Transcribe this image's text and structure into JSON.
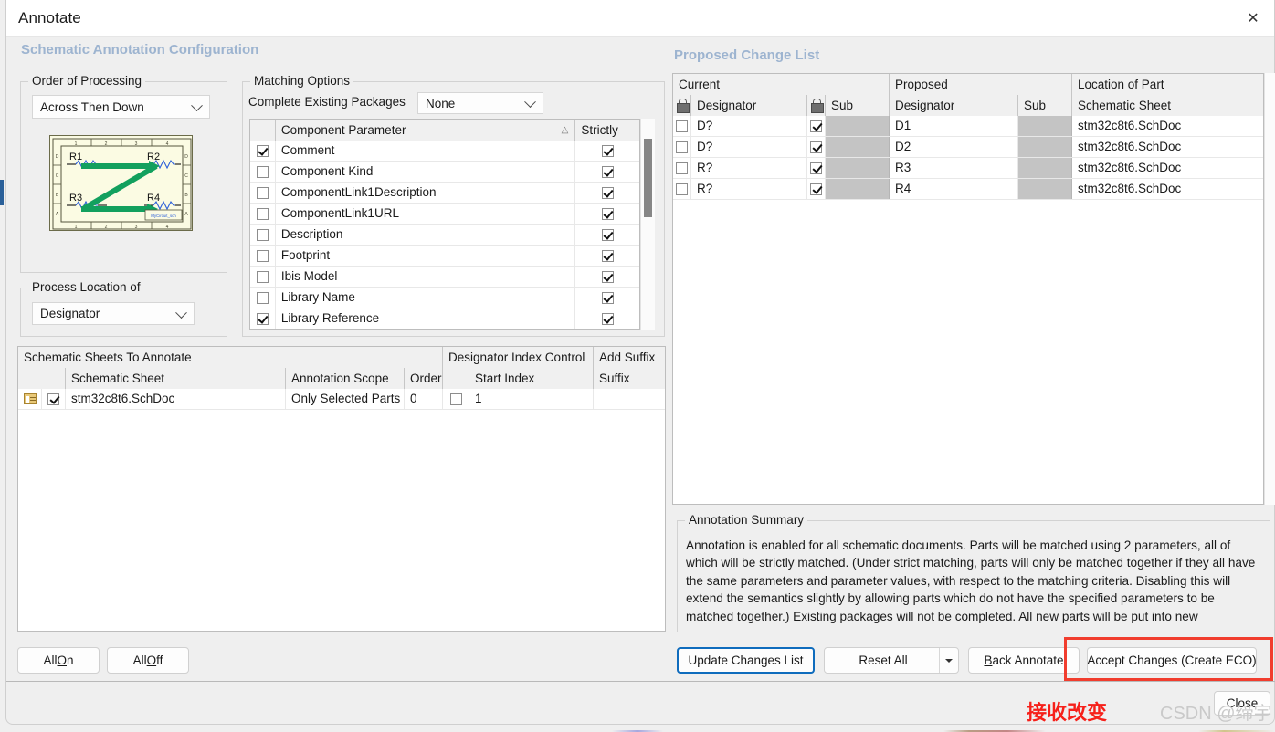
{
  "window": {
    "title": "Annotate",
    "close_icon": "close-icon"
  },
  "left_panel": {
    "heading": "Schematic Annotation Configuration",
    "order_of_processing": {
      "legend": "Order of Processing",
      "value": "Across Then Down",
      "chevron_icon": "chevron-down-icon",
      "preview": {
        "designators": [
          "R1",
          "R2",
          "R3",
          "R4"
        ],
        "border_labels_top": [
          "1",
          "2",
          "3",
          "4"
        ],
        "border_labels_bottom": [
          "1",
          "2",
          "3",
          "4"
        ],
        "border_labels_left": [
          "D",
          "C",
          "B",
          "A"
        ],
        "border_labels_right": [
          "D",
          "C",
          "B",
          "A"
        ],
        "title_block": "MyCircuit_sch",
        "arrow_color": "#12a05e",
        "sheet_color": "#fbfbe3"
      }
    },
    "process_location_of": {
      "legend": "Process Location of",
      "value": "Designator",
      "chevron_icon": "chevron-down-icon"
    },
    "matching_options": {
      "legend": "Matching Options",
      "complete_existing_packages_label": "Complete Existing Packages",
      "complete_existing_packages_value": "None",
      "chevron_icon": "chevron-down-icon",
      "columns": [
        "",
        "Component Parameter",
        "Strictly"
      ],
      "sort_indicator": "△",
      "rows": [
        {
          "checked": true,
          "parameter": "Comment",
          "strictly": true
        },
        {
          "checked": false,
          "parameter": "Component Kind",
          "strictly": true
        },
        {
          "checked": false,
          "parameter": "ComponentLink1Description",
          "strictly": true
        },
        {
          "checked": false,
          "parameter": "ComponentLink1URL",
          "strictly": true
        },
        {
          "checked": false,
          "parameter": "Description",
          "strictly": true
        },
        {
          "checked": false,
          "parameter": "Footprint",
          "strictly": true
        },
        {
          "checked": false,
          "parameter": "Ibis Model",
          "strictly": true
        },
        {
          "checked": false,
          "parameter": "Library Name",
          "strictly": true
        },
        {
          "checked": true,
          "parameter": "Library Reference",
          "strictly": true
        }
      ]
    },
    "sheets_grid": {
      "group_headers": [
        "Schematic Sheets To Annotate",
        "Designator Index Control",
        "Add Suffix"
      ],
      "columns": [
        "",
        "",
        "Schematic Sheet",
        "Annotation Scope",
        "Order",
        "",
        "Start Index",
        "Suffix"
      ],
      "rows": [
        {
          "doc_icon": "document-icon",
          "enabled": true,
          "schematic_sheet": "stm32c8t6.SchDoc",
          "annotation_scope": "Only Selected Parts",
          "order": "0",
          "index_enabled": false,
          "start_index": "1",
          "suffix": ""
        }
      ]
    },
    "buttons": {
      "all_on": {
        "pre": "All ",
        "accel": "O",
        "post": "n"
      },
      "all_off": {
        "pre": "All ",
        "accel": "O",
        "post": "ff"
      }
    }
  },
  "right_panel": {
    "heading": "Proposed Change List",
    "change_list": {
      "group_headers": [
        "Current",
        "Proposed",
        "Location of Part"
      ],
      "sub_headers": {
        "current_lock_icon": "lock-icon",
        "current_designator": "Designator",
        "current_sub_lock_icon": "lock-icon",
        "current_sub": "Sub",
        "proposed_designator": "Designator",
        "proposed_sub": "Sub",
        "location": "Schematic Sheet"
      },
      "rows": [
        {
          "selected": false,
          "current_designator": "D?",
          "current_sub_locked": true,
          "proposed_designator": "D1",
          "location": "stm32c8t6.SchDoc"
        },
        {
          "selected": false,
          "current_designator": "D?",
          "current_sub_locked": true,
          "proposed_designator": "D2",
          "location": "stm32c8t6.SchDoc"
        },
        {
          "selected": false,
          "current_designator": "R?",
          "current_sub_locked": true,
          "proposed_designator": "R3",
          "location": "stm32c8t6.SchDoc"
        },
        {
          "selected": false,
          "current_designator": "R?",
          "current_sub_locked": true,
          "proposed_designator": "R4",
          "location": "stm32c8t6.SchDoc"
        }
      ]
    },
    "summary": {
      "legend": "Annotation Summary",
      "text": "Annotation is enabled for all schematic documents. Parts will be matched using 2 parameters, all of which will be strictly matched. (Under strict matching, parts will only be matched together if they all have the same parameters and parameter values, with respect to the matching criteria. Disabling this will extend the semantics slightly by allowing parts which do not have the specified parameters to be matched together.) Existing packages will not be completed. All new parts will be put into new"
    },
    "buttons": {
      "update_changes_list": "Update Changes List",
      "reset_all": "Reset All",
      "reset_all_dropdown_icon": "caret-down-icon",
      "back_annotate": {
        "accel": "B",
        "post": "ack Annotate"
      },
      "accept_changes": "Accept Changes (Create ECO)",
      "close": "Close"
    }
  },
  "annotations": {
    "chinese_note": "接收改变",
    "watermark": "CSDN @缔宇",
    "highlight_color": "#f13d2e"
  }
}
